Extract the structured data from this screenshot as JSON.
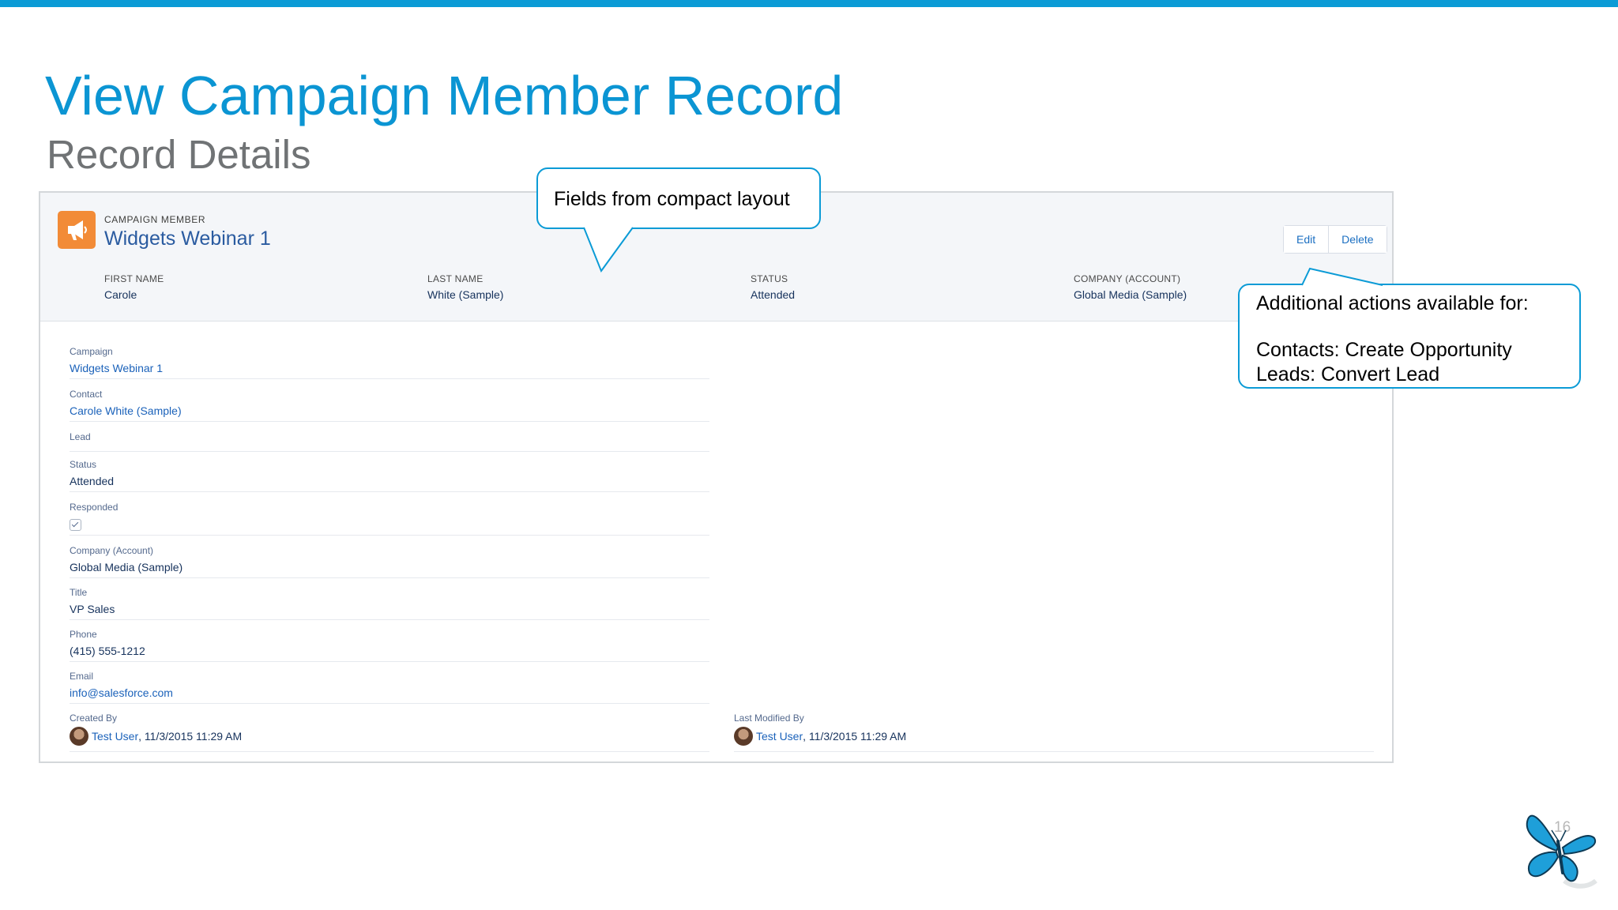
{
  "slide": {
    "title": "View Campaign Member Record",
    "subtitle": "Record Details",
    "page_number": "16"
  },
  "record": {
    "type_label": "CAMPAIGN MEMBER",
    "name": "Widgets Webinar 1",
    "icon": "megaphone-icon",
    "actions": {
      "edit": "Edit",
      "delete": "Delete"
    }
  },
  "highlights": [
    {
      "label": "FIRST NAME",
      "value": "Carole"
    },
    {
      "label": "LAST NAME",
      "value": "White (Sample)"
    },
    {
      "label": "STATUS",
      "value": "Attended"
    },
    {
      "label": "COMPANY (ACCOUNT)",
      "value": "Global Media (Sample)"
    }
  ],
  "details": {
    "campaign": {
      "label": "Campaign",
      "value": "Widgets Webinar 1"
    },
    "contact": {
      "label": "Contact",
      "value": "Carole White (Sample)"
    },
    "lead": {
      "label": "Lead",
      "value": ""
    },
    "status": {
      "label": "Status",
      "value": "Attended"
    },
    "responded": {
      "label": "Responded",
      "checked": true
    },
    "company": {
      "label": "Company (Account)",
      "value": "Global Media (Sample)"
    },
    "title": {
      "label": "Title",
      "value": "VP Sales"
    },
    "phone": {
      "label": "Phone",
      "value": "(415) 555-1212"
    },
    "email": {
      "label": "Email",
      "value": "info@salesforce.com"
    },
    "created_by": {
      "label": "Created By",
      "user": "Test User",
      "timestamp": ", 11/3/2015 11:29 AM"
    },
    "last_modified_by": {
      "label": "Last Modified By",
      "user": "Test User",
      "timestamp": ", 11/3/2015 11:29 AM"
    }
  },
  "callouts": {
    "compact_layout": "Fields from compact layout",
    "actions_heading": "Additional actions available for:",
    "actions_contacts": "Contacts: Create Opportunity",
    "actions_leads": "Leads: Convert Lead"
  },
  "colors": {
    "accent": "#0b9bd6",
    "title": "#0b95d3",
    "record_icon": "#f28b37",
    "link": "#1b62ba"
  }
}
